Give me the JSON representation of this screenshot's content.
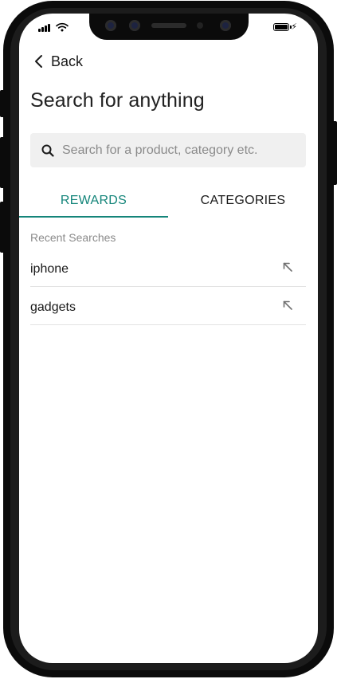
{
  "status_bar": {
    "signal_icon": "cellular-signal-icon",
    "wifi_icon": "wifi-icon",
    "battery_icon": "battery-charging-icon"
  },
  "nav": {
    "back_label": "Back",
    "back_icon": "chevron-left-icon"
  },
  "page": {
    "title": "Search for anything"
  },
  "search": {
    "placeholder": "Search for a product, category etc.",
    "value": "",
    "icon": "search-icon"
  },
  "tabs": [
    {
      "label": "REWARDS",
      "active": true
    },
    {
      "label": "CATEGORIES",
      "active": false
    }
  ],
  "recent": {
    "heading": "Recent Searches",
    "items": [
      {
        "label": "iphone",
        "icon": "arrow-up-left-icon"
      },
      {
        "label": "gadgets",
        "icon": "arrow-up-left-icon"
      }
    ]
  },
  "colors": {
    "accent": "#14857a",
    "text_primary": "#1a1a1a",
    "text_muted": "#8a8a8a",
    "search_bg": "#f0f0f0",
    "device_frame": "#0b0b0b"
  }
}
